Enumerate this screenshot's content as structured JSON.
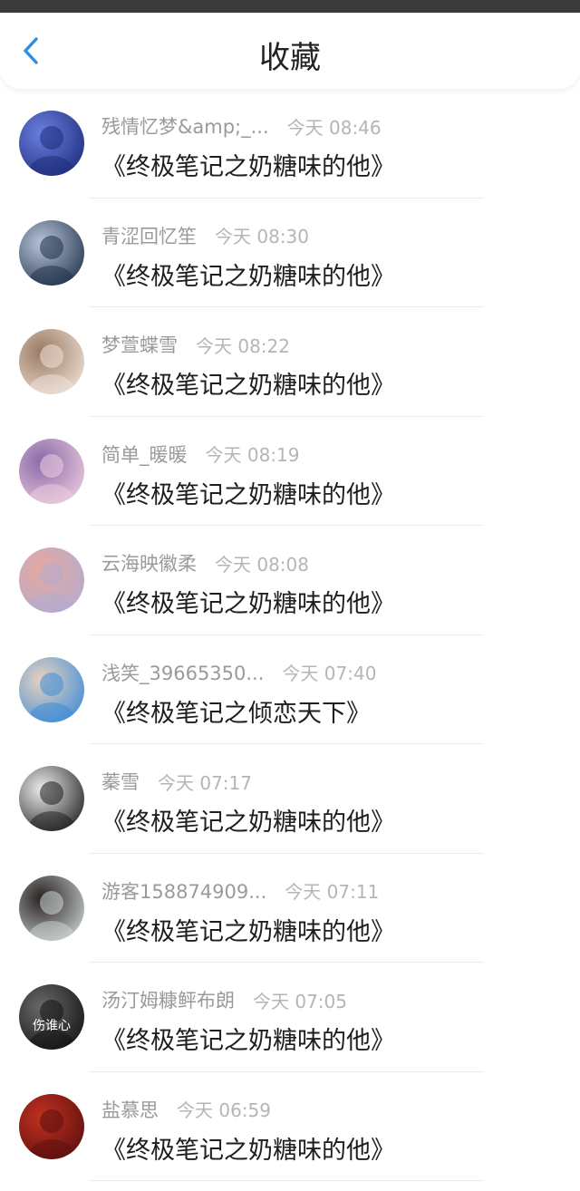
{
  "header": {
    "title": "收藏",
    "back_icon": "chevron-left-icon",
    "accent_color": "#2a8fe0"
  },
  "items": [
    {
      "nickname": "残情忆梦&amp;_...",
      "time": "今天 08:46",
      "book": "《终极笔记之奶糖味的他》",
      "avatar_colors": [
        "#1b2a78",
        "#6a7fe0"
      ]
    },
    {
      "nickname": "青涩回忆笙",
      "time": "今天 08:30",
      "book": "《终极笔记之奶糖味的他》",
      "avatar_colors": [
        "#1e2e48",
        "#b8c4d8"
      ]
    },
    {
      "nickname": "梦萱蝶雪",
      "time": "今天 08:22",
      "book": "《终极笔记之奶糖味的他》",
      "avatar_colors": [
        "#f2e4dc",
        "#9a7a62"
      ]
    },
    {
      "nickname": "简单_暖暖",
      "time": "今天 08:19",
      "book": "《终极笔记之奶糖味的他》",
      "avatar_colors": [
        "#f0cfe0",
        "#8a6aa8"
      ]
    },
    {
      "nickname": "云海映徽柔",
      "time": "今天 08:08",
      "book": "《终极笔记之奶糖味的他》",
      "avatar_colors": [
        "#b2acd0",
        "#e6a8a0"
      ]
    },
    {
      "nickname": "浅笑_39665350...",
      "time": "今天 07:40",
      "book": "《终极笔记之倾恋天下》",
      "avatar_colors": [
        "#3a8ad8",
        "#e8d2c0"
      ]
    },
    {
      "nickname": "蓁雪",
      "time": "今天 07:17",
      "book": "《终极笔记之奶糖味的他》",
      "avatar_colors": [
        "#1a1a1a",
        "#ededed"
      ]
    },
    {
      "nickname": "游客158874909...",
      "time": "今天 07:11",
      "book": "《终极笔记之奶糖味的他》",
      "avatar_colors": [
        "#cfd8d8",
        "#2a2020"
      ]
    },
    {
      "nickname": "汤汀姆糠鲆布朗",
      "time": "今天 07:05",
      "book": "《终极笔记之奶糖味的他》",
      "avatar_colors": [
        "#101010",
        "#6a6a6a"
      ],
      "avatar_caption": "伤谁心"
    },
    {
      "nickname": "盐慕思",
      "time": "今天 06:59",
      "book": "《终极笔记之奶糖味的他》",
      "avatar_colors": [
        "#5a0e0e",
        "#c03020"
      ]
    }
  ]
}
